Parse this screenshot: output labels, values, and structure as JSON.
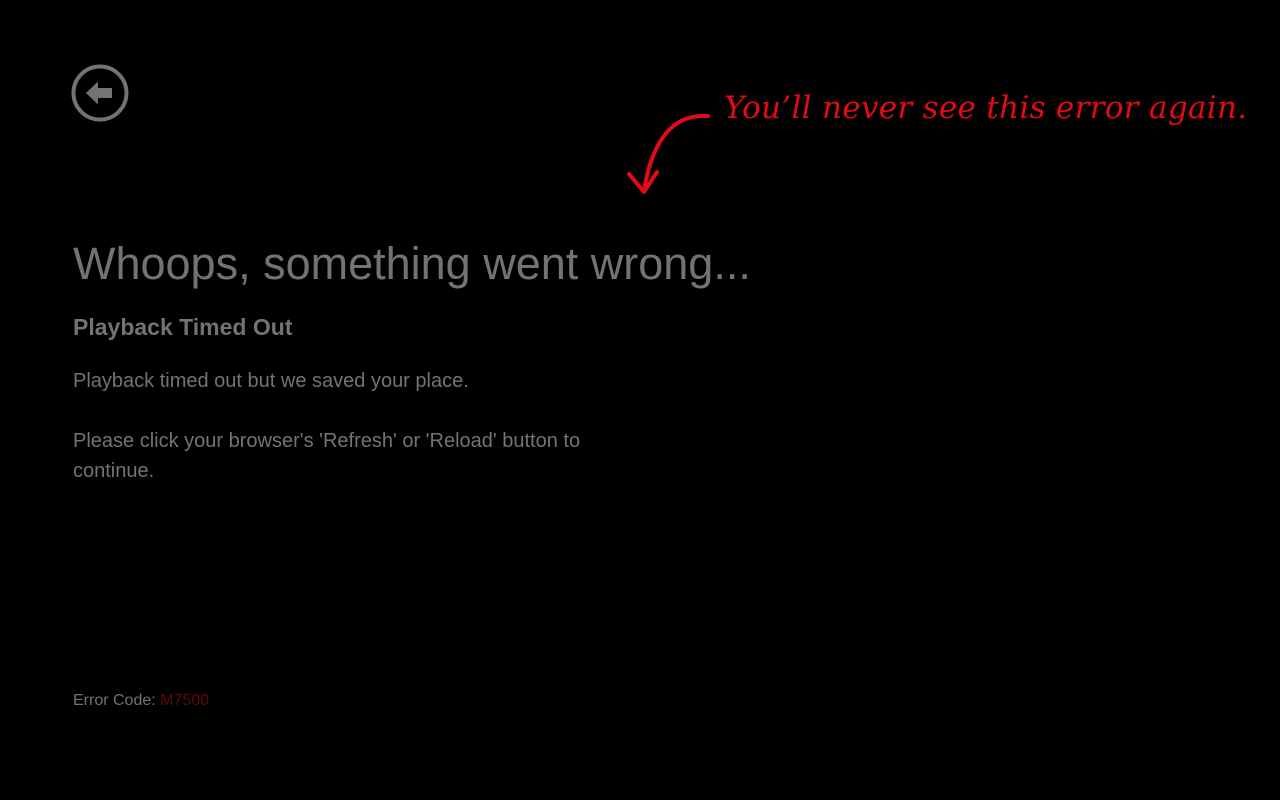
{
  "colors": {
    "background": "#000000",
    "text": "#737373",
    "accent": "#e50914",
    "error_code": "#5a0a0a"
  },
  "back_button": {
    "icon": "arrow-left-circle-icon"
  },
  "annotation": {
    "text": "You’ll never see this error again.",
    "icon": "curved-arrow-down-icon"
  },
  "error": {
    "headline": "Whoops, something went wrong...",
    "title": "Playback Timed Out",
    "message_1": "Playback timed out but we saved your place.",
    "message_2": "Please click your browser's 'Refresh' or 'Reload' button to continue.",
    "code_label": "Error Code:",
    "code_value": "M7500"
  }
}
